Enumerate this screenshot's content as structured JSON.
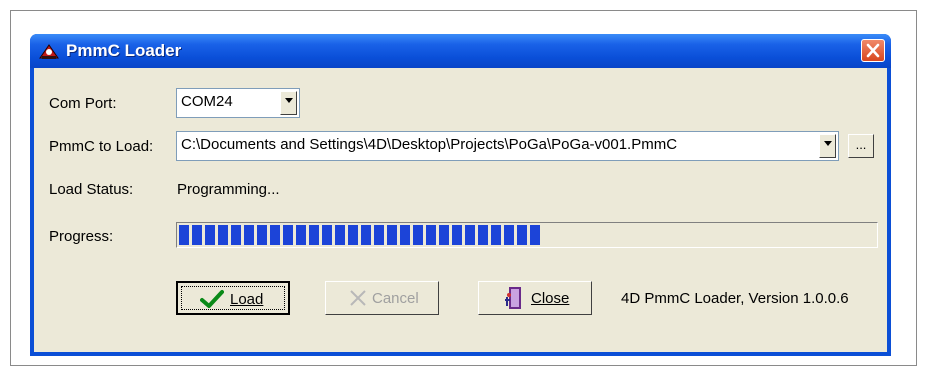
{
  "window": {
    "title": "PmmC Loader",
    "icon": "app-logo-icon",
    "close_icon": "close-icon"
  },
  "com_port": {
    "label": "Com Port:",
    "value": "COM24"
  },
  "pmmc": {
    "label": "PmmC to Load:",
    "value": "C:\\Documents and Settings\\4D\\Desktop\\Projects\\PoGa\\PoGa-v001.PmmC",
    "browse_label": "..."
  },
  "status": {
    "label": "Load Status:",
    "value": "Programming..."
  },
  "progress": {
    "label": "Progress:",
    "fraction": 0.52
  },
  "buttons": {
    "load": {
      "label": "Load",
      "icon": "checkmark-icon"
    },
    "cancel": {
      "label": "Cancel",
      "icon": "x-icon"
    },
    "close": {
      "label": "Close",
      "icon": "door-exit-icon"
    }
  },
  "version_text": "4D PmmC Loader, Version 1.0.0.6",
  "colors": {
    "title_bar": "#0a4fd8",
    "progress_fill": "#1c44d8",
    "dialog_bg": "#ece9d8"
  }
}
